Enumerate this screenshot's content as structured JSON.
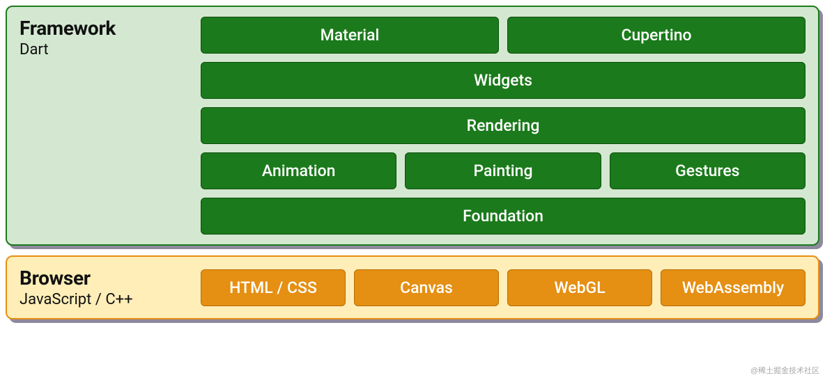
{
  "framework": {
    "title": "Framework",
    "subtitle": "Dart",
    "rows": [
      [
        "Material",
        "Cupertino"
      ],
      [
        "Widgets"
      ],
      [
        "Rendering"
      ],
      [
        "Animation",
        "Painting",
        "Gestures"
      ],
      [
        "Foundation"
      ]
    ]
  },
  "browser": {
    "title": "Browser",
    "subtitle": "JavaScript / C++",
    "rows": [
      [
        "HTML / CSS",
        "Canvas",
        "WebGL",
        "WebAssembly"
      ]
    ]
  },
  "watermark": "@稀土掘金技术社区",
  "colors": {
    "framework_bg": "#d4e8d1",
    "framework_border": "#1b7a1b",
    "framework_block": "#1b7a1b",
    "browser_bg": "#ffeeb8",
    "browser_border": "#e58f13",
    "browser_block": "#e58f13"
  }
}
